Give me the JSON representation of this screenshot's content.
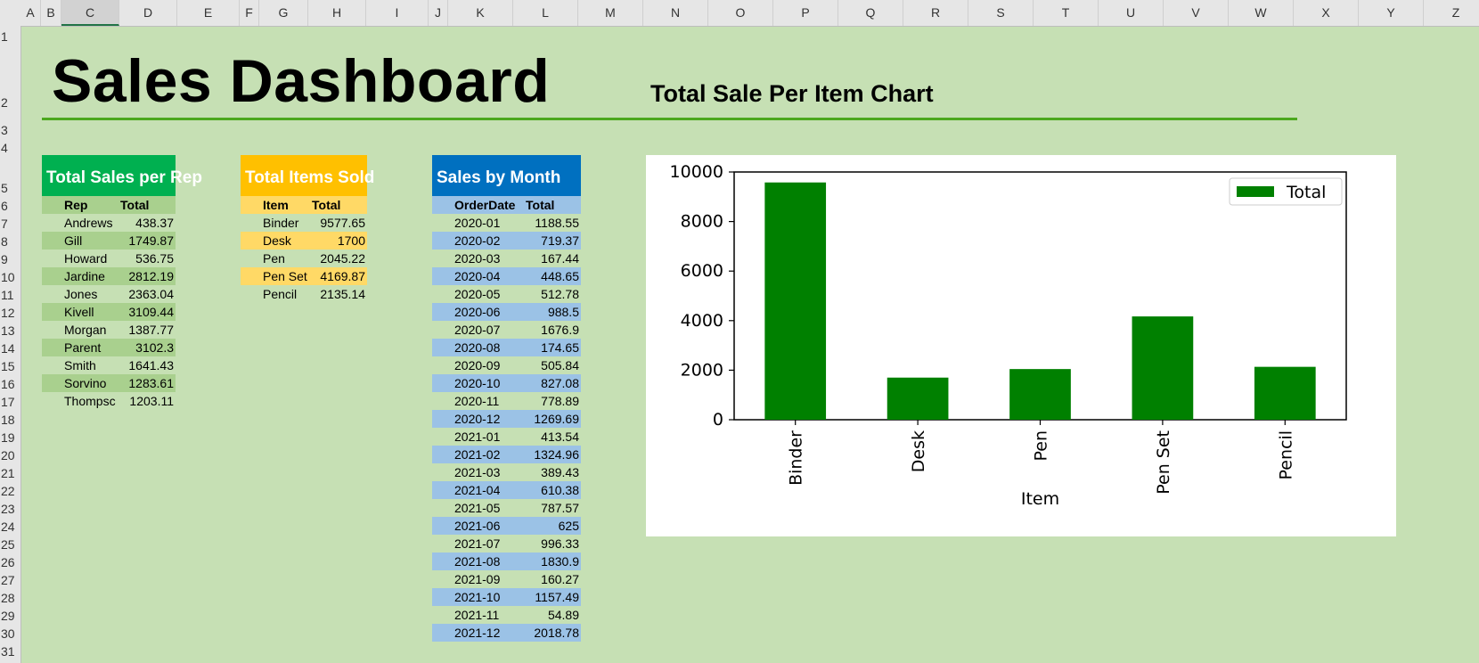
{
  "sheet": {
    "columns": [
      "A",
      "B",
      "C",
      "D",
      "E",
      "F",
      "G",
      "H",
      "I",
      "J",
      "K",
      "L",
      "M",
      "N",
      "O",
      "P",
      "Q",
      "R",
      "S",
      "T",
      "U",
      "V",
      "W",
      "X",
      "Y",
      "Z"
    ],
    "selected_column": "C",
    "rows": [
      "1",
      "2",
      "3",
      "4",
      "5",
      "6",
      "7",
      "8",
      "9",
      "10",
      "11",
      "12",
      "13",
      "14",
      "15",
      "16",
      "17",
      "18",
      "19",
      "20",
      "21",
      "22",
      "23",
      "24",
      "25",
      "26",
      "27",
      "28",
      "29",
      "30",
      "31"
    ]
  },
  "dashboard": {
    "title": "Sales Dashboard",
    "chart_title": "Total Sale Per Item Chart"
  },
  "colors": {
    "background": "#c6e0b4",
    "rep_header": "#00b050",
    "items_header": "#ffc000",
    "month_header": "#0070c0",
    "bar": "#008000"
  },
  "rep_table": {
    "header": "Total Sales per Rep",
    "col1": "Rep",
    "col2": "Total",
    "rows": [
      {
        "name": "Andrews",
        "total": "438.37"
      },
      {
        "name": "Gill",
        "total": "1749.87"
      },
      {
        "name": "Howard",
        "total": "536.75"
      },
      {
        "name": "Jardine",
        "total": "2812.19"
      },
      {
        "name": "Jones",
        "total": "2363.04"
      },
      {
        "name": "Kivell",
        "total": "3109.44"
      },
      {
        "name": "Morgan",
        "total": "1387.77"
      },
      {
        "name": "Parent",
        "total": "3102.3"
      },
      {
        "name": "Smith",
        "total": "1641.43"
      },
      {
        "name": "Sorvino",
        "total": "1283.61"
      },
      {
        "name": "Thompsc",
        "total": "1203.11"
      }
    ]
  },
  "items_table": {
    "header": "Total Items Sold",
    "col1": "Item",
    "col2": "Total",
    "rows": [
      {
        "name": "Binder",
        "total": "9577.65"
      },
      {
        "name": "Desk",
        "total": "1700"
      },
      {
        "name": "Pen",
        "total": "2045.22"
      },
      {
        "name": "Pen Set",
        "total": "4169.87"
      },
      {
        "name": "Pencil",
        "total": "2135.14"
      }
    ]
  },
  "month_table": {
    "header": "Sales by Month",
    "col1": "OrderDate",
    "col2": "Total",
    "rows": [
      {
        "name": "2020-01",
        "total": "1188.55"
      },
      {
        "name": "2020-02",
        "total": "719.37"
      },
      {
        "name": "2020-03",
        "total": "167.44"
      },
      {
        "name": "2020-04",
        "total": "448.65"
      },
      {
        "name": "2020-05",
        "total": "512.78"
      },
      {
        "name": "2020-06",
        "total": "988.5"
      },
      {
        "name": "2020-07",
        "total": "1676.9"
      },
      {
        "name": "2020-08",
        "total": "174.65"
      },
      {
        "name": "2020-09",
        "total": "505.84"
      },
      {
        "name": "2020-10",
        "total": "827.08"
      },
      {
        "name": "2020-11",
        "total": "778.89"
      },
      {
        "name": "2020-12",
        "total": "1269.69"
      },
      {
        "name": "2021-01",
        "total": "413.54"
      },
      {
        "name": "2021-02",
        "total": "1324.96"
      },
      {
        "name": "2021-03",
        "total": "389.43"
      },
      {
        "name": "2021-04",
        "total": "610.38"
      },
      {
        "name": "2021-05",
        "total": "787.57"
      },
      {
        "name": "2021-06",
        "total": "625"
      },
      {
        "name": "2021-07",
        "total": "996.33"
      },
      {
        "name": "2021-08",
        "total": "1830.9"
      },
      {
        "name": "2021-09",
        "total": "160.27"
      },
      {
        "name": "2021-10",
        "total": "1157.49"
      },
      {
        "name": "2021-11",
        "total": "54.89"
      },
      {
        "name": "2021-12",
        "total": "2018.78"
      }
    ]
  },
  "chart_data": {
    "type": "bar",
    "categories": [
      "Binder",
      "Desk",
      "Pen",
      "Pen Set",
      "Pencil"
    ],
    "series": [
      {
        "name": "Total",
        "values": [
          9577.65,
          1700,
          2045.22,
          4169.87,
          2135.14
        ]
      }
    ],
    "xlabel": "Item",
    "ylabel": "",
    "ylim": [
      0,
      10000
    ],
    "yticks": [
      "0",
      "2000",
      "4000",
      "6000",
      "8000",
      "10000"
    ],
    "legend": "upper-right",
    "legend_label": "Total",
    "color": "#008000"
  }
}
